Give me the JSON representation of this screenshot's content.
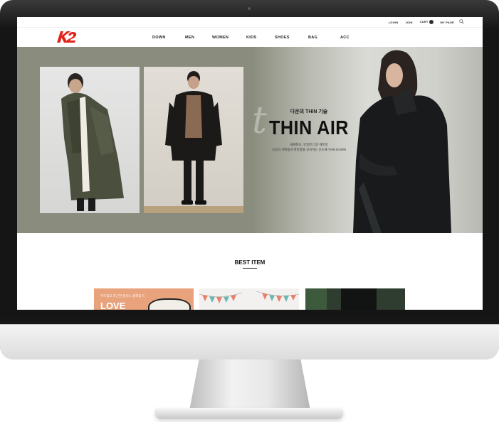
{
  "topbar": {
    "login": "LOGIN",
    "join": "JOIN",
    "cart": "CART",
    "cart_count": "0",
    "mypage": "MY PAGE"
  },
  "logo": {
    "text": "K2"
  },
  "nav": {
    "items": [
      "DOWN",
      "MEN",
      "WOMEN",
      "KIDS",
      "SHOES",
      "BAG",
      "ACC"
    ]
  },
  "hero": {
    "kicker": "다운의 THIN 기술",
    "title": "THIN AIR",
    "desc_line1": "세계최초, 유일한 다운 제어의",
    "desc_line2": "극강의 가벼움과 따뜻함을 선사하는 신소재 THIN DOWN"
  },
  "best": {
    "title": "BEST ITEM",
    "card1_small": "부드럽고 포근한 플리스 끌레입기",
    "card1_big": "LOVE"
  },
  "colors": {
    "brand_red": "#e2231a",
    "hero_bg": "#8a8c7d",
    "card_peach": "#e8a27c"
  }
}
